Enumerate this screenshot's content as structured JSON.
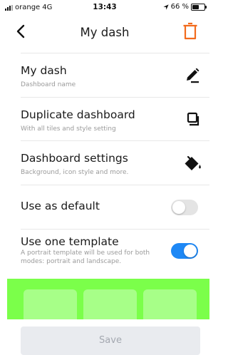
{
  "status_bar": {
    "carrier": "orange",
    "network": "4G",
    "time": "13:43",
    "battery_text": "66 %",
    "battery_level": 0.66
  },
  "header": {
    "title": "My dash",
    "back_icon": "chevron-left-icon",
    "delete_icon": "trash-icon",
    "delete_color": "#f26b1d"
  },
  "rows": {
    "name": {
      "title": "My dash",
      "subtitle": "Dashboard name",
      "icon": "pencil-icon"
    },
    "duplicate": {
      "title": "Duplicate dashboard",
      "subtitle": "With all tiles and style setting",
      "icon": "copy-icon"
    },
    "settings": {
      "title": "Dashboard settings",
      "subtitle": "Background, icon style and more.",
      "icon": "paint-bucket-icon"
    },
    "default": {
      "title": "Use as default",
      "toggle_on": false
    },
    "template": {
      "title": "Use one template",
      "subtitle": "A portrait template will be used for both modes: portrait and landscape.",
      "toggle_on": true
    }
  },
  "colors": {
    "toggle_on": "#1e88f5",
    "toggle_off": "#e4e4e4",
    "preview_background": "#7bff4a",
    "tile_background": "#a7ff88"
  },
  "save_button": {
    "label": "Save",
    "enabled": false
  }
}
